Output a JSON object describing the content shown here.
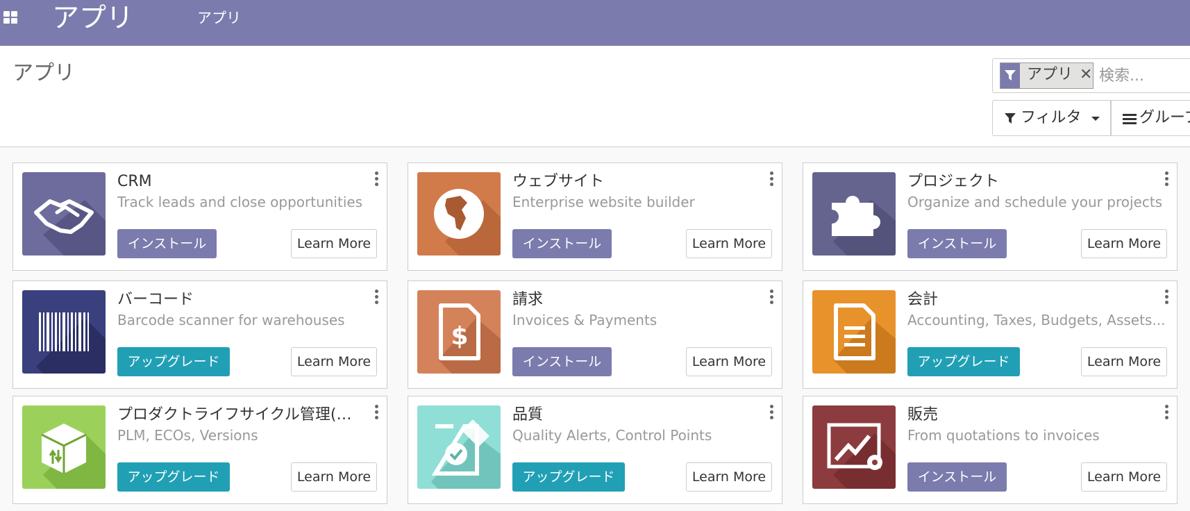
{
  "navbar": {
    "brand": "アプリ",
    "menu_item": "アプリ"
  },
  "control_panel": {
    "title": "アプリ",
    "search": {
      "facet_label": "アプリ",
      "placeholder": "検索..."
    },
    "filter_label": "フィルタ",
    "group_label": "グループ"
  },
  "colors": {
    "navbar": "#7c7bad",
    "install_button": "#7c7bad",
    "upgrade_button": "#21a0b5"
  },
  "apps": [
    {
      "name": "CRM",
      "summary": "Track leads and close opportunities",
      "action": "インストール",
      "action_type": "install",
      "learn_more": "Learn More",
      "icon": "handshake-icon",
      "icon_color": "#6e6c9c"
    },
    {
      "name": "ウェブサイト",
      "summary": "Enterprise website builder",
      "action": "インストール",
      "action_type": "install",
      "learn_more": "Learn More",
      "icon": "globe-icon",
      "icon_color": "#d17b4b"
    },
    {
      "name": "プロジェクト",
      "summary": "Organize and schedule your projects",
      "action": "インストール",
      "action_type": "install",
      "learn_more": "Learn More",
      "icon": "puzzle-icon",
      "icon_color": "#65648f"
    },
    {
      "name": "バーコード",
      "summary": "Barcode scanner for warehouses",
      "action": "アップグレード",
      "action_type": "upgrade",
      "learn_more": "Learn More",
      "icon": "barcode-icon",
      "icon_color": "#3a3f7e"
    },
    {
      "name": "請求",
      "summary": "Invoices & Payments",
      "action": "インストール",
      "action_type": "install",
      "learn_more": "Learn More",
      "icon": "invoice-icon",
      "icon_color": "#d4825a"
    },
    {
      "name": "会計",
      "summary": "Accounting, Taxes, Budgets, Assets...",
      "action": "アップグレード",
      "action_type": "upgrade",
      "learn_more": "Learn More",
      "icon": "document-icon",
      "icon_color": "#e8922c"
    },
    {
      "name": "プロダクトライフサイクル管理(…",
      "summary": "PLM, ECOs, Versions",
      "action": "アップグレード",
      "action_type": "upgrade",
      "learn_more": "Learn More",
      "icon": "box-icon",
      "icon_color": "#9bd15a"
    },
    {
      "name": "品質",
      "summary": "Quality Alerts, Control Points",
      "action": "アップグレード",
      "action_type": "upgrade",
      "learn_more": "Learn More",
      "icon": "quality-icon",
      "icon_color": "#8fdfd6"
    },
    {
      "name": "販売",
      "summary": "From quotations to invoices",
      "action": "インストール",
      "action_type": "install",
      "learn_more": "Learn More",
      "icon": "sales-chart-icon",
      "icon_color": "#8c3b3e"
    }
  ]
}
